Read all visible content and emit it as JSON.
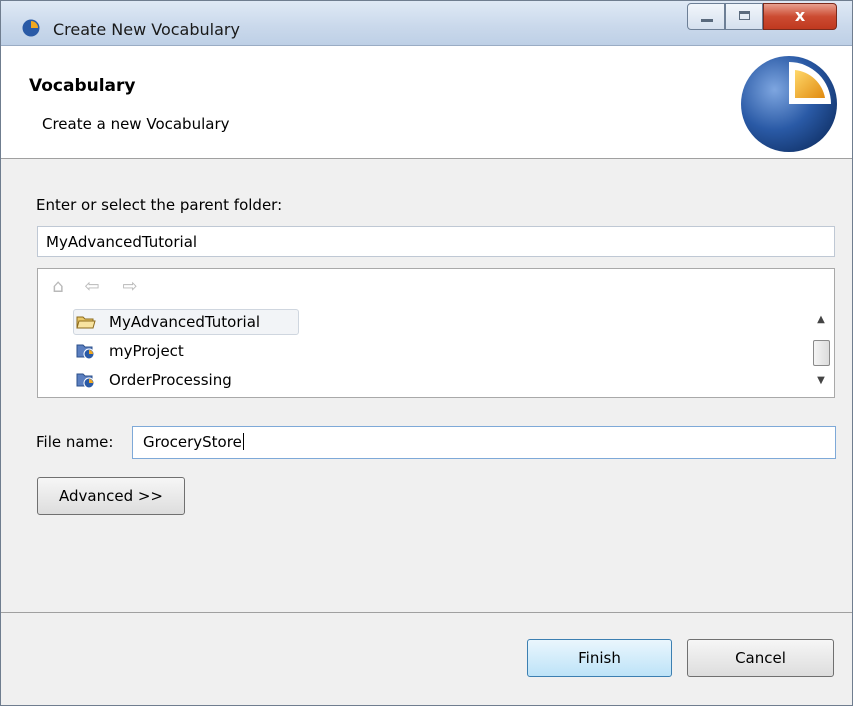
{
  "window": {
    "title": "Create New Vocabulary",
    "app_icon": "app-logo-icon",
    "controls": {
      "minimize": "minimize-icon",
      "maximize": "maximize-icon",
      "close": "x"
    }
  },
  "header": {
    "title": "Vocabulary",
    "description": "Create a new Vocabulary",
    "logo": "wizard-logo-icon"
  },
  "parent_folder": {
    "label": "Enter or select the parent folder:",
    "value": "MyAdvancedTutorial"
  },
  "tree": {
    "toolbar": [
      "home-icon",
      "back-arrow-icon",
      "forward-arrow-icon"
    ],
    "items": [
      {
        "label": "MyAdvancedTutorial",
        "icon": "open-folder-icon",
        "selected": true
      },
      {
        "label": "myProject",
        "icon": "project-icon",
        "selected": false
      },
      {
        "label": "OrderProcessing",
        "icon": "project-icon",
        "selected": false
      }
    ]
  },
  "file_name": {
    "label": "File name:",
    "value": "GroceryStore"
  },
  "buttons": {
    "advanced": "Advanced >>",
    "finish": "Finish",
    "cancel": "Cancel"
  },
  "colors": {
    "accent": "#3c7fb1",
    "close_button": "#c0391f",
    "logo_blue": "#2a5aa6",
    "logo_orange": "#f0a820"
  }
}
